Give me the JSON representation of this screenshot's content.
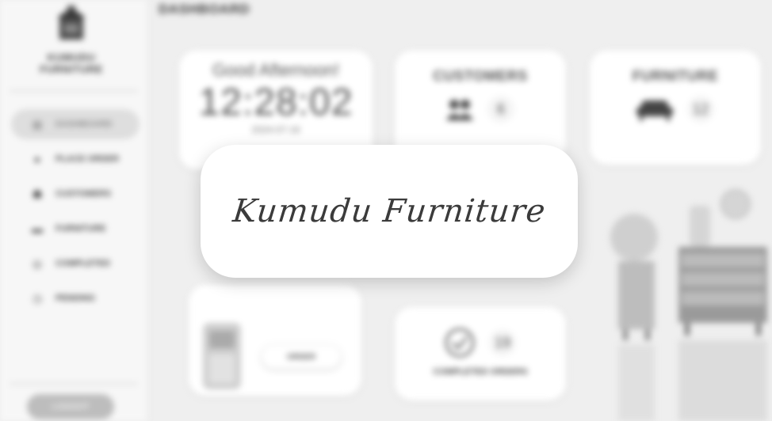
{
  "app": {
    "brand": "KUMUDU\nFURNITURE",
    "brand_line1": "KUMUDU",
    "brand_line2": "FURNITURE"
  },
  "sidebar": {
    "items": [
      {
        "label": "DASHBOARD",
        "icon": "dashboard-icon",
        "active": true
      },
      {
        "label": "PLACE ORDER",
        "icon": "cart-icon",
        "active": false
      },
      {
        "label": "CUSTOMERS",
        "icon": "user-icon",
        "active": false
      },
      {
        "label": "FURNITURE",
        "icon": "sofa-icon",
        "active": false
      },
      {
        "label": "COMPLETED",
        "icon": "check-icon",
        "active": false
      },
      {
        "label": "PENDING",
        "icon": "clock-icon",
        "active": false
      }
    ],
    "logout_label": "LOGOUT"
  },
  "main": {
    "title": "DASHBOARD",
    "greeting": "Good Afternoon!",
    "time": "12:28:02",
    "date": "2024-07-16",
    "customers": {
      "title": "CUSTOMERS",
      "count": "6"
    },
    "furniture": {
      "title": "FURNITURE",
      "count": "12"
    },
    "completed": {
      "label": "COMPLETED ORDERS",
      "count": "19"
    },
    "order_button": "ORDER"
  },
  "splash": {
    "title": "Kumudu Furniture"
  },
  "colors": {
    "background": "#efefef",
    "card": "#ffffff",
    "sidebar": "#f7f7f7",
    "text": "#3a3a3a"
  }
}
